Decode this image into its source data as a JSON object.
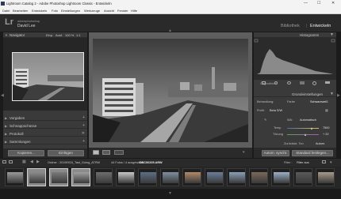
{
  "window": {
    "title": "Lightroom Catalog 2 - Adobe Photoshop Lightroom Classic - Entwickeln",
    "minimize": "—",
    "maximize": "☐",
    "close": "✕"
  },
  "menu": [
    "Datei",
    "Bearbeiten",
    "Entwickeln",
    "Foto",
    "Einstellungen",
    "Werkzeuge",
    "Ansicht",
    "Fenster",
    "Hilfe"
  ],
  "identity": {
    "logo": "Lr",
    "provider": "adobephotoshop",
    "user": "David Lee"
  },
  "modules": {
    "library": "Bibliothek",
    "separator": "|",
    "develop": "Entwickeln"
  },
  "left_panel": {
    "navigator": {
      "label": "Navigator",
      "options": [
        "Einp.",
        "Ausf.",
        "100 %",
        "1:1"
      ]
    },
    "sections": [
      "Vorgaben",
      "Schnappschüsse",
      "Protokoll",
      "Sammlungen"
    ],
    "buttons": {
      "copy": "Kopieren...",
      "paste": "Einfügen"
    }
  },
  "right_panel": {
    "histogram": {
      "label": "Histogramm"
    },
    "original_photo": "Originalfoto",
    "basic": {
      "label": "Grundeinstellungen",
      "treatment_label": "Behandlung:",
      "treatment_color": "Farbe",
      "treatment_bw": "Schwarzweiß",
      "profile_label": "Profil:",
      "profile_value": "Beta S/W",
      "wb_label": "WA:",
      "wb_value": "Automatisch",
      "temp_label": "Temp.",
      "temp_value": "7500",
      "tint_label": "Tönung",
      "tint_value": "+ 22",
      "tone_label": "Zurückstz. Ton",
      "tone_value": "Autom."
    },
    "buttons": {
      "sync": "Autom. synchr.",
      "reset": "Standard festlegen..."
    }
  },
  "filmstrip": {
    "path": "Ordner : 20190915_Tast_Going_ATRW",
    "count": "44 Fotos / 4 ausgewählt /",
    "filename": "DSC00205.ARW",
    "filter_label": "Filter :",
    "filter_value": "Filter aus"
  }
}
